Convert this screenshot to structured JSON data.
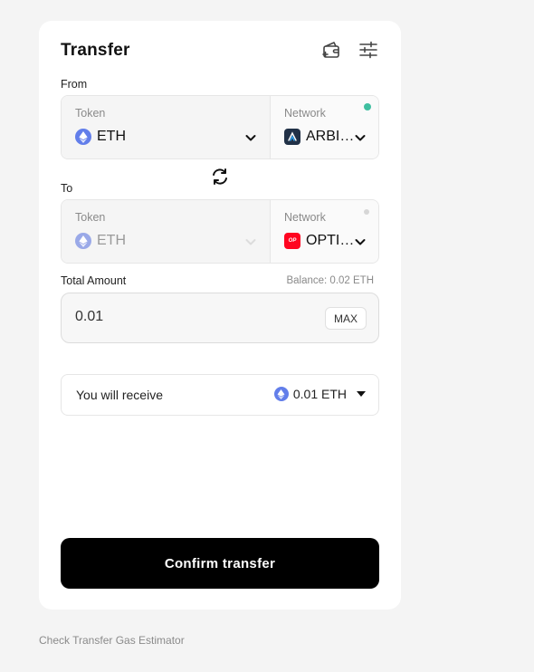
{
  "header": {
    "title": "Transfer",
    "wallet_icon": "wallet-add-icon",
    "settings_icon": "sliders-icon"
  },
  "from": {
    "label": "From",
    "token_caption": "Token",
    "token_value": "ETH",
    "token_icon": "eth-icon",
    "network_caption": "Network",
    "network_value": "ARBI…",
    "network_icon": "arbitrum-icon",
    "status_color": "#3fbfa0"
  },
  "swap_icon": "swap-direction-icon",
  "to": {
    "label": "To",
    "token_caption": "Token",
    "token_value": "ETH",
    "token_icon": "eth-icon",
    "network_caption": "Network",
    "network_value": "OPTI…",
    "network_icon": "optimism-icon",
    "network_icon_text": "OP",
    "status_color": "#d6d6d6"
  },
  "amount": {
    "label": "Total Amount",
    "balance": "Balance: 0.02 ETH",
    "value": "0.01",
    "max_label": "MAX"
  },
  "receive": {
    "label": "You will receive",
    "value": "0.01 ETH"
  },
  "confirm_label": "Confirm transfer",
  "footer_link": "Check Transfer Gas Estimator",
  "colors": {
    "background": "#f4f4f4",
    "card": "#ffffff",
    "primary_button": "#000000",
    "eth": "#627eea",
    "arbitrum": "#213147",
    "optimism": "#ff0420"
  }
}
